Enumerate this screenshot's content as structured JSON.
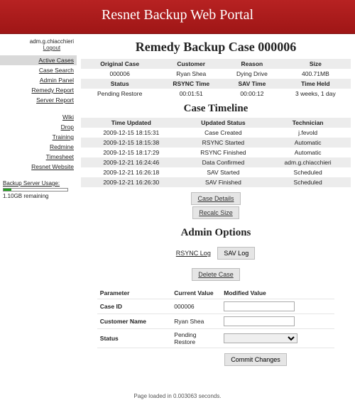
{
  "header": {
    "title": "Resnet Backup Web Portal"
  },
  "user": {
    "name": "adm.g.chiacchieri",
    "logout": "Logout"
  },
  "sidebar": {
    "group1": [
      {
        "label": "Active Cases",
        "active": true
      },
      {
        "label": "Case Search"
      },
      {
        "label": "Admin Panel"
      },
      {
        "label": "Remedy Report"
      },
      {
        "label": "Server Report"
      }
    ],
    "group2": [
      {
        "label": "Wiki"
      },
      {
        "label": "Drop"
      },
      {
        "label": "Training"
      },
      {
        "label": "Redmine"
      },
      {
        "label": "Timesheet"
      },
      {
        "label": "Resnet Website"
      }
    ],
    "storage": {
      "title": "Backup Server Usage:",
      "remaining": "1.10GB remaining",
      "fill_pct": 12
    }
  },
  "page": {
    "title": "Remedy Backup Case 000006",
    "summary": {
      "row1_headers": [
        "Original Case",
        "Customer",
        "Reason",
        "Size"
      ],
      "row1_values": [
        "000006",
        "Ryan Shea",
        "Dying Drive",
        "400.71MB"
      ],
      "row2_headers": [
        "Status",
        "RSYNC Time",
        "SAV Time",
        "Time Held"
      ],
      "row2_values": [
        "Pending Restore",
        "00:01:51",
        "00:00:12",
        "3 weeks, 1 day"
      ]
    },
    "timeline_title": "Case Timeline",
    "timeline_headers": [
      "Time Updated",
      "Updated Status",
      "Technician"
    ],
    "timeline": [
      [
        "2009-12-15 18:15:31",
        "Case Created",
        "j.fevold"
      ],
      [
        "2009-12-15 18:15:38",
        "RSYNC Started",
        "Automatic"
      ],
      [
        "2009-12-15 18:17:29",
        "RSYNC Finished",
        "Automatic"
      ],
      [
        "2009-12-21 16:24:46",
        "Data Confirmed",
        "adm.g.chiacchieri"
      ],
      [
        "2009-12-21 16:26:18",
        "SAV Started",
        "Scheduled"
      ],
      [
        "2009-12-21 16:26:30",
        "SAV Finished",
        "Scheduled"
      ]
    ],
    "buttons": {
      "case_details": "Case Details",
      "recalc": "Recalc Size"
    },
    "admin_title": "Admin Options",
    "logs": {
      "rsync": "RSYNC Log",
      "sav": "SAV Log"
    },
    "delete": "Delete Case",
    "form": {
      "headers": [
        "Parameter",
        "Current Value",
        "Modified Value"
      ],
      "case_id_label": "Case ID",
      "case_id_current": "000006",
      "customer_label": "Customer Name",
      "customer_current": "Ryan Shea",
      "status_label": "Status",
      "status_current": "Pending Restore",
      "commit": "Commit Changes"
    }
  },
  "footer": {
    "text": "Page loaded in 0.003063 seconds."
  }
}
